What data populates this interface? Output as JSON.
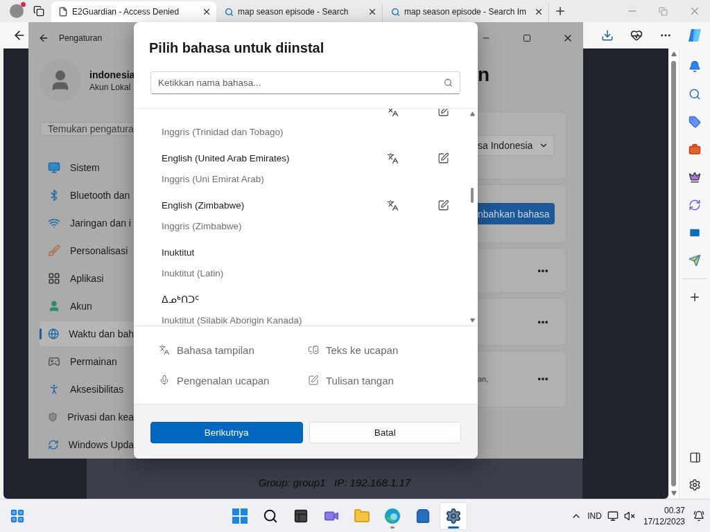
{
  "browser": {
    "tabs": [
      {
        "kind": "page",
        "title": "E2Guardian - Access Denied",
        "selected": true
      },
      {
        "kind": "search",
        "title": "map season episode - Search",
        "selected": false
      },
      {
        "kind": "search",
        "title": "map season episode - Search Im",
        "selected": false
      }
    ],
    "page": {
      "footer_text": "Group: group1   IP: 192.168.1.17"
    }
  },
  "settings": {
    "title": "Pengaturan",
    "user": {
      "name": "indonesia",
      "account": "Akun Lokal"
    },
    "search": {
      "placeholder": "Temukan pengatura"
    },
    "nav": [
      {
        "kind": "system",
        "label": "Sistem",
        "selected": false
      },
      {
        "kind": "bluetooth",
        "label": "Bluetooth dan",
        "selected": false
      },
      {
        "kind": "network",
        "label": "Jaringan dan i",
        "selected": false
      },
      {
        "kind": "personalization",
        "label": "Personalisasi",
        "selected": false
      },
      {
        "kind": "apps",
        "label": "Aplikasi",
        "selected": false
      },
      {
        "kind": "accounts",
        "label": "Akun",
        "selected": false
      },
      {
        "kind": "time",
        "label": "Waktu dan bah",
        "selected": true
      },
      {
        "kind": "gaming",
        "label": "Permainan",
        "selected": false
      },
      {
        "kind": "accessibility",
        "label": "Aksesibilitas",
        "selected": false
      },
      {
        "kind": "privacy",
        "label": "Privasi dan kea",
        "selected": false
      },
      {
        "kind": "update",
        "label": "Windows Upda",
        "selected": false
      }
    ],
    "heading": "n",
    "cards": [
      {
        "kind": "dropdown",
        "value": "sa Indonesia"
      },
      {
        "kind": "button",
        "label": "nbahkan bahasa"
      },
      {
        "kind": "more"
      },
      {
        "kind": "more"
      },
      {
        "kind": "more",
        "text": "an,"
      }
    ]
  },
  "dialog": {
    "title": "Pilih bahasa untuk diinstal",
    "search": {
      "placeholder": "Ketikkan nama bahasa..."
    },
    "languages": [
      {
        "subtitle": "Inggris (Trinidad dan Tobago)",
        "display": true,
        "handwriting": true
      },
      {
        "name": "English (United Arab Emirates)",
        "subtitle": "Inggris (Uni Emirat Arab)",
        "display": true,
        "handwriting": true
      },
      {
        "name": "English (Zimbabwe)",
        "subtitle": "Inggris (Zimbabwe)",
        "display": true,
        "handwriting": true
      },
      {
        "name": "Inuktitut",
        "subtitle": "Inuktitut (Latin)",
        "display": false,
        "handwriting": false
      },
      {
        "name": "ᐃᓄᒃᑎᑐᑦ",
        "subtitle": "Inuktitut (Silabik Aborigin Kanada)",
        "display": false,
        "handwriting": false
      }
    ],
    "legend": [
      {
        "kind": "display",
        "label": "Bahasa tampilan"
      },
      {
        "kind": "tts",
        "label": "Teks ke ucapan"
      },
      {
        "kind": "speech",
        "label": "Pengenalan ucapan"
      },
      {
        "kind": "handwriting",
        "label": "Tulisan tangan"
      }
    ],
    "buttons": [
      {
        "kind": "primary",
        "label": "Berikutnya"
      },
      {
        "kind": "secondary",
        "label": "Batal"
      }
    ]
  },
  "taskbar": {
    "apps": [
      {
        "kind": "start",
        "selected": false,
        "running": false
      },
      {
        "kind": "search",
        "selected": false,
        "running": false
      },
      {
        "kind": "taskview",
        "selected": false,
        "running": false
      },
      {
        "kind": "chat",
        "selected": false,
        "running": false
      },
      {
        "kind": "files",
        "selected": false,
        "running": false
      },
      {
        "kind": "edge",
        "selected": false,
        "running": true
      },
      {
        "kind": "store",
        "selected": false,
        "running": false
      },
      {
        "kind": "settings",
        "selected": true,
        "running": true
      }
    ],
    "language": "IND",
    "time": "00.37",
    "date": "17/12/2023"
  }
}
